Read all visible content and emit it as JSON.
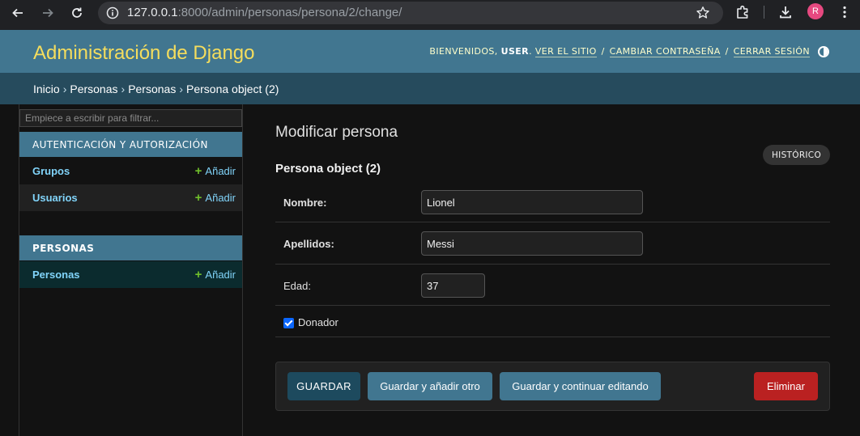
{
  "browser": {
    "url_host": "127.0.0.1",
    "url_path": ":8000/admin/personas/persona/2/change/",
    "profile_initial": "R",
    "icons": [
      "back-arrow-icon",
      "forward-arrow-icon",
      "reload-icon",
      "site-info-icon",
      "bookmark-star-icon",
      "extensions-icon",
      "download-icon"
    ]
  },
  "header": {
    "branding": "Administración de Django",
    "welcome": "Bienvenidos,",
    "user": "user",
    "view_site": "Ver el sitio",
    "change_password": "Cambiar contraseña",
    "logout": "Cerrar sesión",
    "separator": "/"
  },
  "breadcrumbs": {
    "items": [
      "Inicio",
      "Personas",
      "Personas"
    ],
    "current": "Persona object (2)",
    "separator": "›"
  },
  "sidebar": {
    "filter_placeholder": "Empiece a escribir para filtrar...",
    "modules": [
      {
        "caption": "Autenticación y autorización",
        "models": [
          {
            "name": "Grupos",
            "add": "Añadir"
          },
          {
            "name": "Usuarios",
            "add": "Añadir"
          }
        ]
      },
      {
        "caption": "Personas",
        "models": [
          {
            "name": "Personas",
            "add": "Añadir"
          }
        ]
      }
    ],
    "add_symbol": "+"
  },
  "content": {
    "title": "Modificar persona",
    "history": "Histórico",
    "object_title": "Persona object (2)",
    "fields": {
      "nombre": {
        "label": "Nombre:",
        "value": "Lionel"
      },
      "apellidos": {
        "label": "Apellidos:",
        "value": "Messi"
      },
      "edad": {
        "label": "Edad:",
        "value": "37"
      },
      "donador": {
        "label": "Donador",
        "checked": true
      }
    },
    "buttons": {
      "save": "Guardar",
      "save_add": "Guardar y añadir otro",
      "save_continue": "Guardar y continuar editando",
      "delete": "Eliminar"
    }
  },
  "colors": {
    "header": "#417690",
    "breadcrumbs": "#264b5d",
    "branding": "#f5dd5d",
    "link": "#81d4fa",
    "add_plus": "#70bf2b",
    "delete": "#ba2121"
  }
}
